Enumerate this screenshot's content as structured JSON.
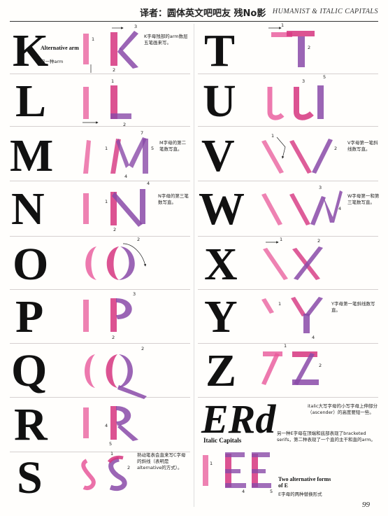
{
  "header": {
    "chinese_title": "译者：圆体英文吧吧友 残No影",
    "english_title": "HUMANIST & ITALIC CAPITALS"
  },
  "left_column": [
    {
      "letter": "K",
      "alt_label": "Alternative arm",
      "alt_label_cn": "另一种arm",
      "note_cn": "K字母残部的arm数层五笔画来写。"
    },
    {
      "letter": "L"
    },
    {
      "letter": "M",
      "note_cn": "M字母的第二笔数写直。"
    },
    {
      "letter": "N",
      "note_cn": "N字母的第三笔数写直。"
    },
    {
      "letter": "O"
    },
    {
      "letter": "P"
    },
    {
      "letter": "Q"
    },
    {
      "letter": "R"
    },
    {
      "letter": "S",
      "note_cn": "熟动笔表会直来写C字母的斜线（表明是alternative的方式）。"
    }
  ],
  "right_column": [
    {
      "letter": "T"
    },
    {
      "letter": "U"
    },
    {
      "letter": "V",
      "note_cn": "V字母第一笔斜线数写直。"
    },
    {
      "letter": "W",
      "note_cn": "W字母第一和第三笔数写直。"
    },
    {
      "letter": "X"
    },
    {
      "letter": "Y",
      "note_cn": "Y字母第一笔斜线数写直。"
    },
    {
      "letter": "Z"
    },
    {
      "letter": "ERd",
      "note_cn": "italic大写字母的小写字母上伸部分（ascender）的高度要短一些。"
    }
  ],
  "italic_section": {
    "label": "Italic Capitals",
    "note_cn": "另一种E字母在顶端和底部表现了bracketed serifs，第二种表现了一个直的主干和直的arm。",
    "alt_label": "Two alternative forms of E",
    "alt_label_cn": "E字母的两种替换形式"
  },
  "page_number": "99",
  "colors": {
    "pink": "#e8589a",
    "magenta": "#d6357f",
    "purple": "#8a4aa8",
    "ink": "#111111"
  }
}
